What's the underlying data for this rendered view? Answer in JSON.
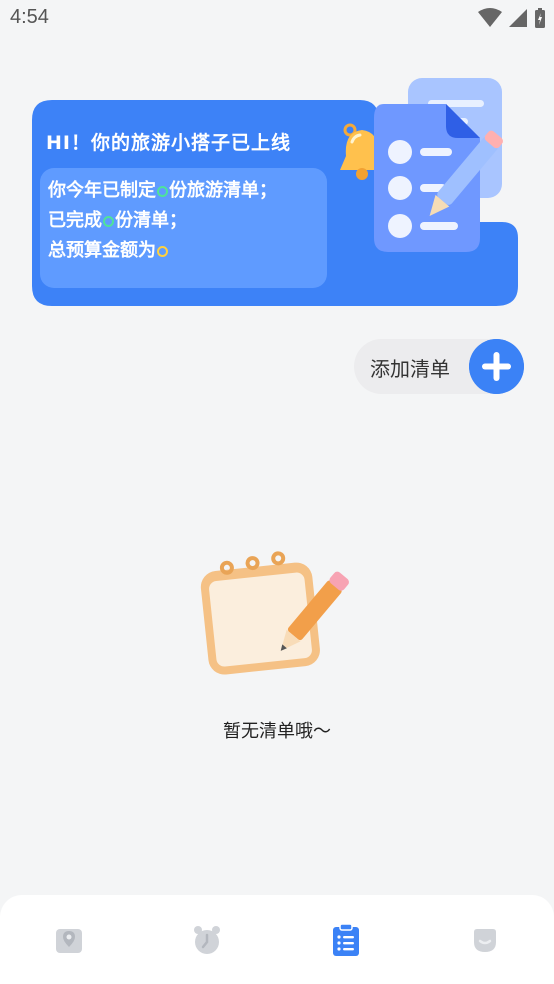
{
  "status_bar": {
    "time": "4:54"
  },
  "banner": {
    "greeting": "HI！你的旅游小搭子已上线",
    "stats": {
      "line1_prefix": "你今年已制定",
      "line1_value": "0",
      "line1_suffix": "份旅游清单；",
      "line2_prefix": "已完成",
      "line2_value": "0",
      "line2_suffix": "份清单；",
      "line3_prefix": "总预算金额为",
      "line3_value": "0"
    },
    "accent_color": "#3d82f7"
  },
  "add_list": {
    "label": "添加清单",
    "icon": "plus-icon"
  },
  "empty_state": {
    "message": "暂无清单哦～",
    "icon": "notepad-pencil-icon"
  },
  "tab_bar": {
    "active_index": 2,
    "tabs": [
      {
        "icon": "map-pin-icon"
      },
      {
        "icon": "alarm-clock-icon"
      },
      {
        "icon": "clipboard-list-icon"
      },
      {
        "icon": "profile-icon"
      }
    ]
  },
  "colors": {
    "background": "#f4f5f6",
    "active_tab": "#3b82f6",
    "inactive_tab": "#d0d3d8"
  }
}
